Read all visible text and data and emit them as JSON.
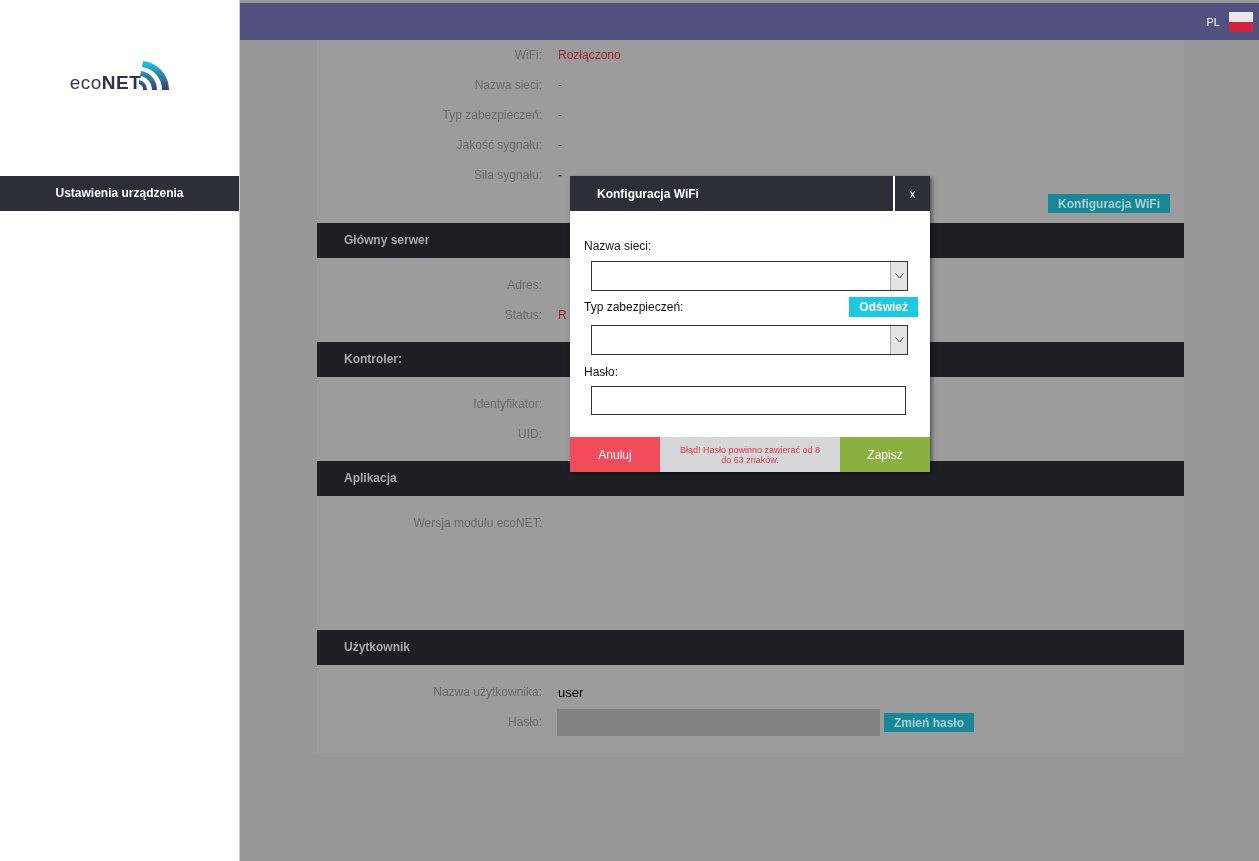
{
  "logo": {
    "prefix": "eco",
    "brand": "NET"
  },
  "sidebar": {
    "items": [
      {
        "label": "Ustawienia urządzenia",
        "selected": true
      }
    ]
  },
  "header": {
    "language": "PL"
  },
  "wifi_section": {
    "rows": [
      {
        "label": "WiFi:",
        "value": "Rozłączono",
        "kind": "error"
      },
      {
        "label": "Nazwa sieci:",
        "value": "-",
        "kind": "text"
      },
      {
        "label": "Typ zabezpieczeń:",
        "value": "-",
        "kind": "text"
      },
      {
        "label": "Jakość sygnału:",
        "value": "-",
        "kind": "text"
      },
      {
        "label": "Siła sygnału:",
        "value": "-",
        "kind": "text"
      }
    ],
    "button": "Konfiguracja WiFi"
  },
  "sections": [
    {
      "title": "Główny serwer",
      "rows": [
        {
          "label": "Adres:",
          "kind": "text"
        },
        {
          "label": "Status:",
          "value": "R",
          "kind": "error"
        }
      ]
    },
    {
      "title": "Kontroler:",
      "rows": [
        {
          "label": "Identyfikator:",
          "kind": "text"
        },
        {
          "label": "UID:",
          "kind": "text"
        }
      ]
    },
    {
      "title": "Aplikacja",
      "tall": true,
      "rows": [
        {
          "label": "Wersja modułu ecoNET:",
          "kind": "text"
        }
      ]
    },
    {
      "title": "Użytkownik",
      "rows": [
        {
          "label": "Nazwa użytkownika:",
          "value": "user",
          "kind": "plain"
        },
        {
          "label": "Hasło:",
          "kind": "password",
          "button": "Zmień hasło"
        }
      ]
    }
  ],
  "dialog": {
    "title": "Konfiguracja WiFi",
    "close": "x",
    "network_label": "Nazwa sieci:",
    "security_label": "Typ zabezpieczeń:",
    "refresh_button": "Odśwież",
    "password_label": "Hasło:",
    "cancel_button": "Anuluj",
    "error": "Błąd! Hasło powinno zawierać od 8 do 63 znaków.",
    "save_button": "Zapisz"
  }
}
